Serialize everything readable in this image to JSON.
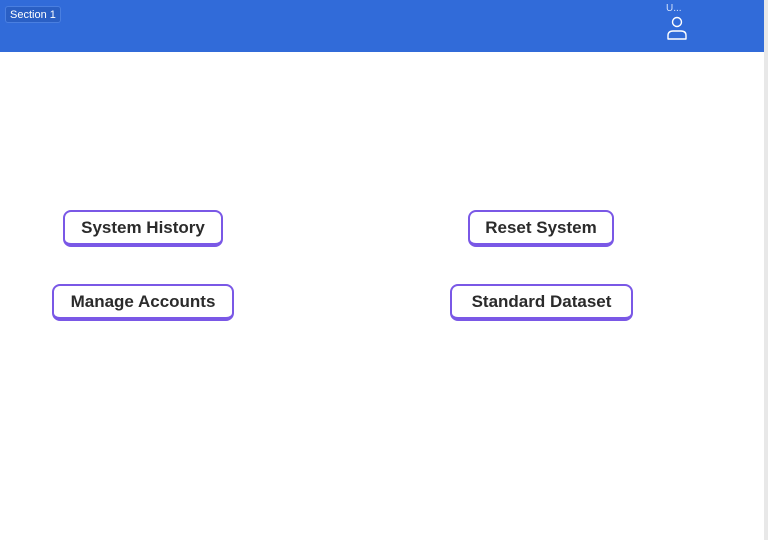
{
  "header": {
    "section_label": "Section 1",
    "user_label": "U...",
    "user_icon": "user-icon",
    "background_color": "#316bd9"
  },
  "buttons": {
    "system_history": "System History",
    "reset_system": "Reset System",
    "manage_accounts": "Manage Accounts",
    "standard_dataset": "Standard Dataset",
    "accent_color": "#7a58e6"
  }
}
